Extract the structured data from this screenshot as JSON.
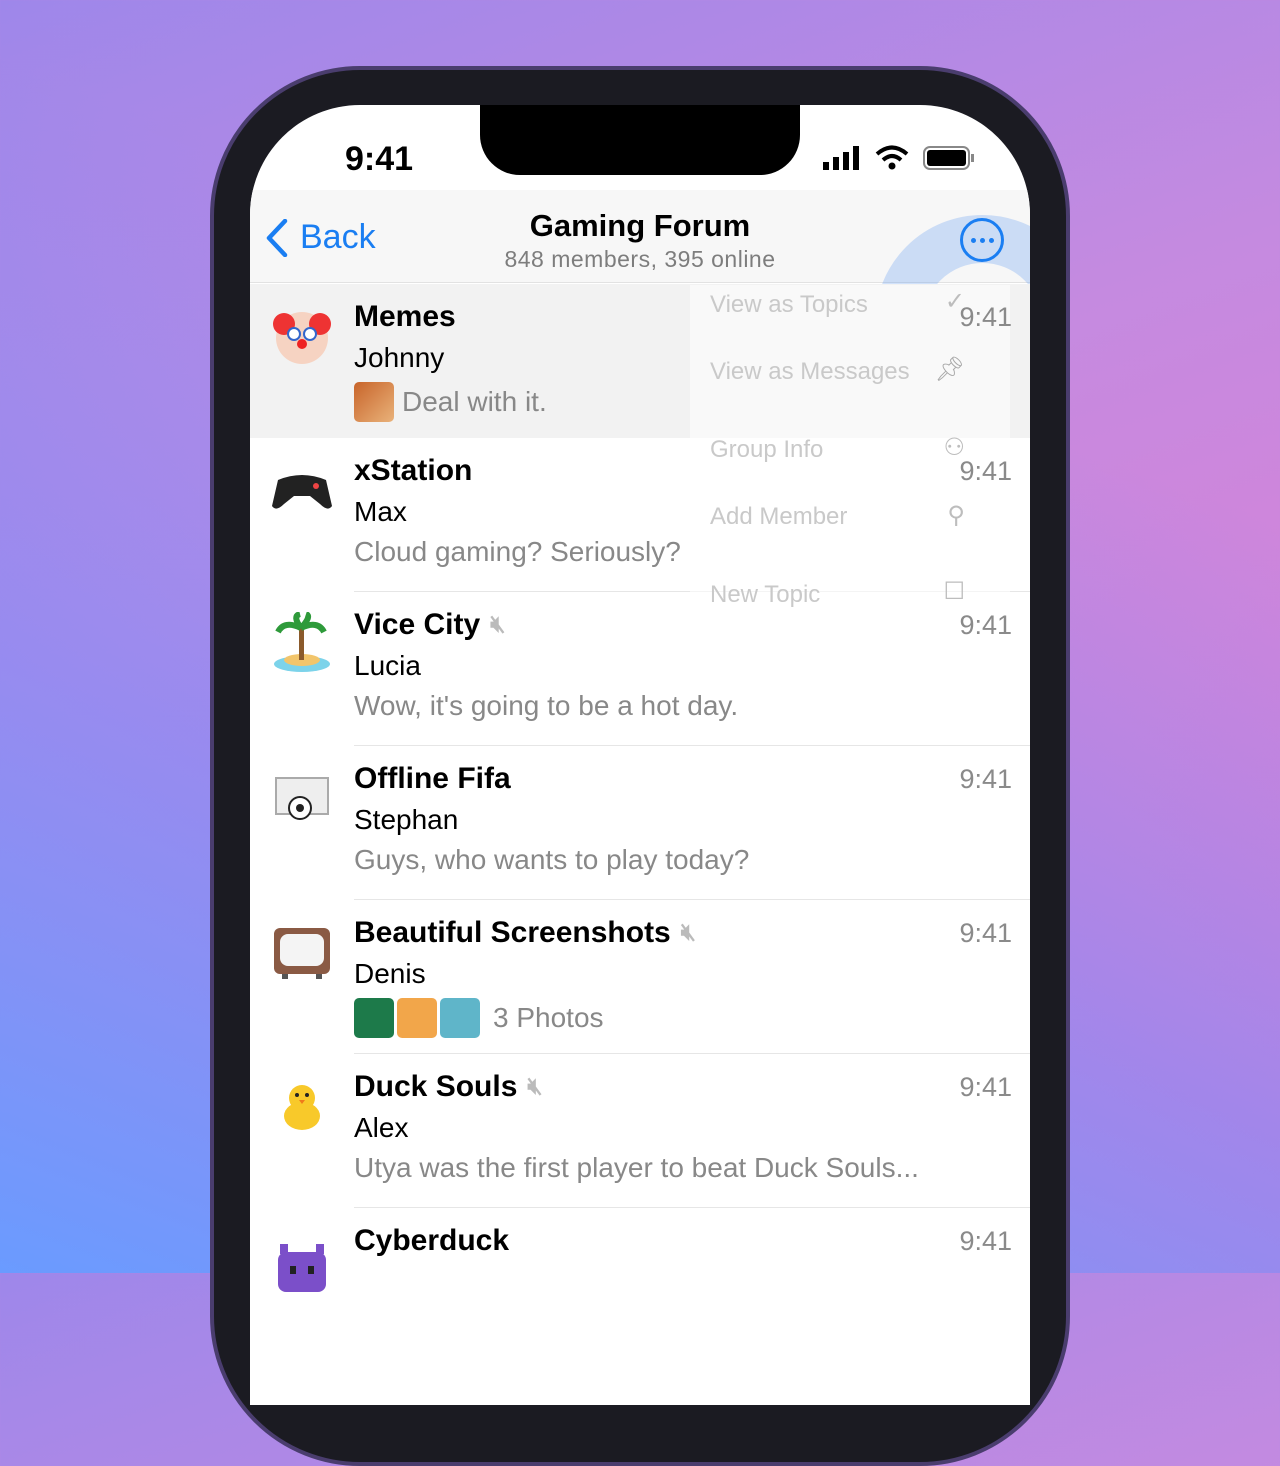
{
  "status": {
    "time": "9:41"
  },
  "nav": {
    "back": "Back",
    "title": "Gaming Forum",
    "subtitle": "848 members, 395 online"
  },
  "menu": {
    "items": [
      {
        "label": "View as Topics",
        "icon": "checkmark-icon"
      },
      {
        "label": "View as Messages",
        "icon": "pin-icon"
      },
      {
        "label": "Group Info",
        "icon": "group-icon"
      },
      {
        "label": "Add Member",
        "icon": "add-person-icon"
      },
      {
        "label": "New Topic",
        "icon": "compose-icon"
      }
    ]
  },
  "chats": [
    {
      "name": "Memes",
      "sender": "Johnny",
      "preview": "Deal with it.",
      "time": "9:41",
      "muted": false,
      "avatar": "clown-emoji"
    },
    {
      "name": "xStation",
      "sender": "Max",
      "preview": "Cloud gaming? Seriously?",
      "time": "9:41",
      "muted": false,
      "avatar": "gamepad-emoji"
    },
    {
      "name": "Vice City",
      "sender": "Lucia",
      "preview": "Wow, it's going to be a hot day.",
      "time": "9:41",
      "muted": true,
      "avatar": "island-emoji"
    },
    {
      "name": "Offline Fifa",
      "sender": "Stephan",
      "preview": "Guys, who wants to play today?",
      "time": "9:41",
      "muted": false,
      "avatar": "soccer-goal-emoji"
    },
    {
      "name": "Beautiful Screenshots",
      "sender": "Denis",
      "preview": "3 Photos",
      "time": "9:41",
      "muted": true,
      "avatar": "tv-emoji"
    },
    {
      "name": "Duck Souls",
      "sender": "Alex",
      "preview": "Utya was the first player to beat Duck Souls...",
      "time": "9:41",
      "muted": true,
      "avatar": "chick-emoji"
    },
    {
      "name": "Cyberduck",
      "sender": "",
      "preview": "",
      "time": "9:41",
      "muted": false,
      "avatar": "space-invader-emoji"
    }
  ],
  "colors": {
    "accent": "#1a7ef2"
  }
}
